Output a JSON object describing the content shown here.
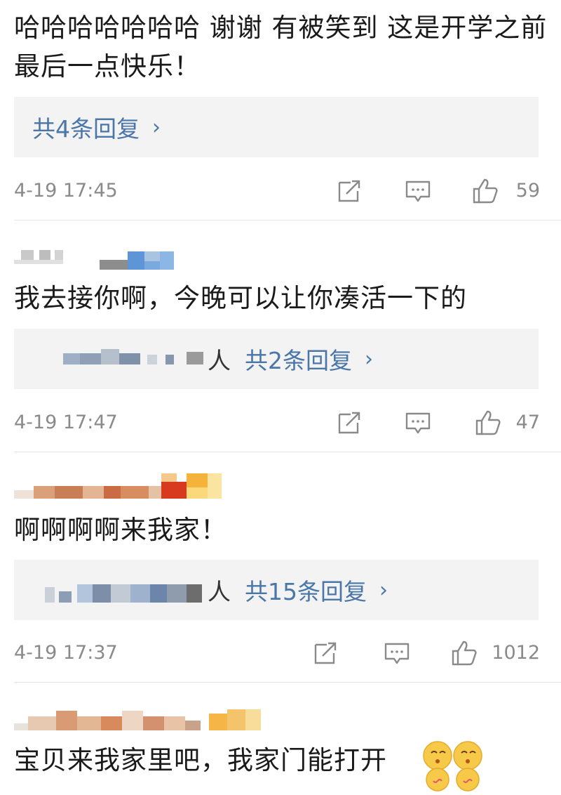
{
  "comments": [
    {
      "text": "哈哈哈哈哈哈哈 谢谢 有被笑到 这是开学之前最后一点快乐！",
      "replies": "共4条回复",
      "time": "4-19 17:45",
      "likes": "59"
    },
    {
      "text": "我去接你啊，今晚可以让你凑活一下的",
      "reply_people": "人",
      "replies": "共2条回复",
      "time": "4-19 17:47",
      "likes": "47"
    },
    {
      "text": "啊啊啊啊来我家！",
      "reply_people": "人",
      "replies": "共15条回复",
      "time": "4-19 17:37",
      "likes": "1012"
    },
    {
      "text": "宝贝来我家里吧，我家门能打开"
    }
  ],
  "icons": {
    "repost": "share-icon",
    "comment": "comment-icon",
    "like": "thumbs-up-icon",
    "chevron": "chevron-right-icon"
  },
  "colors": {
    "link_blue": "#4a76a8",
    "meta_gray": "#8a8a8a",
    "reply_bg": "#f3f3f3"
  }
}
